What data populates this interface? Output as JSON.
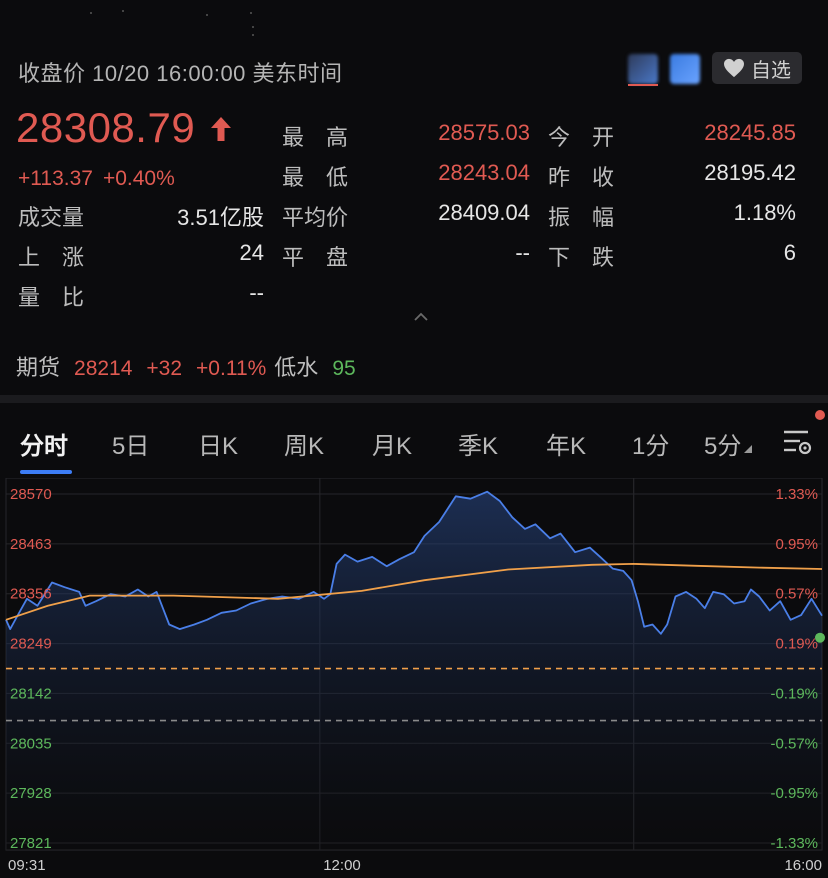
{
  "header": {
    "title": "收盘价 10/20 16:00:00 美东时间",
    "watchlist_label": "自选"
  },
  "quote": {
    "last": "28308.79",
    "change": "+113.37",
    "change_pct": "+0.40%"
  },
  "stats": [
    {
      "label": "最　高",
      "value": "28575.03",
      "color": "red"
    },
    {
      "label": "今　开",
      "value": "28245.85",
      "color": "red"
    },
    {
      "label": "最　低",
      "value": "28243.04",
      "color": "red"
    },
    {
      "label": "昨　收",
      "value": "28195.42",
      "color": "white"
    },
    {
      "label": "成交量",
      "value": "3.51亿股",
      "color": "white"
    },
    {
      "label": "平均价",
      "value": "28409.04",
      "color": "white"
    },
    {
      "label": "振　幅",
      "value": "1.18%",
      "color": "white"
    },
    {
      "label": "上　涨",
      "value": "24",
      "color": "white"
    },
    {
      "label": "平　盘",
      "value": "--",
      "color": "white"
    },
    {
      "label": "下　跌",
      "value": "6",
      "color": "white"
    },
    {
      "label": "量　比",
      "value": "--",
      "color": "white"
    }
  ],
  "futures": {
    "label": "期货",
    "price": "28214",
    "change": "+32",
    "change_pct": "+0.11%",
    "basis_label": "低水",
    "basis": "95"
  },
  "tabs": [
    "分时",
    "5日",
    "日K",
    "周K",
    "月K",
    "季K",
    "年K",
    "1分",
    "5分"
  ],
  "active_tab": 0,
  "colors": {
    "up": "#e05a52",
    "down": "#5db85c",
    "price_line": "#4a7fe8",
    "avg_line": "#f0a04a",
    "accent": "#3d7df5"
  },
  "icons": {
    "watchlist": "heart-icon",
    "direction": "up-arrow-icon",
    "expand": "chevron-up-icon",
    "settings": "chart-settings-icon"
  },
  "chart_data": {
    "type": "line",
    "title": "",
    "xlabel": "",
    "ylabel": "",
    "x_ticks": [
      "09:31",
      "12:00",
      "16:00"
    ],
    "y_ticks_left": [
      "28570",
      "28463",
      "28356",
      "28249",
      "28142",
      "28035",
      "27928",
      "27821"
    ],
    "y_ticks_right": [
      "1.33%",
      "0.95%",
      "0.57%",
      "0.19%",
      "-0.19%",
      "-0.57%",
      "-0.95%",
      "-1.33%"
    ],
    "ylim": [
      27821,
      28570
    ],
    "prev_close": 28195.42,
    "session_minutes": 390,
    "grid": true,
    "series": [
      {
        "name": "",
        "role": "price",
        "points": [
          [
            0,
            28300
          ],
          [
            2,
            28280
          ],
          [
            5,
            28305
          ],
          [
            10,
            28345
          ],
          [
            15,
            28330
          ],
          [
            22,
            28380
          ],
          [
            28,
            28370
          ],
          [
            35,
            28360
          ],
          [
            38,
            28330
          ],
          [
            43,
            28340
          ],
          [
            50,
            28355
          ],
          [
            57,
            28350
          ],
          [
            63,
            28365
          ],
          [
            68,
            28350
          ],
          [
            72,
            28360
          ],
          [
            75,
            28325
          ],
          [
            78,
            28290
          ],
          [
            83,
            28280
          ],
          [
            90,
            28290
          ],
          [
            96,
            28300
          ],
          [
            103,
            28315
          ],
          [
            110,
            28320
          ],
          [
            117,
            28335
          ],
          [
            125,
            28345
          ],
          [
            132,
            28350
          ],
          [
            140,
            28345
          ],
          [
            147,
            28360
          ],
          [
            152,
            28345
          ],
          [
            155,
            28355
          ],
          [
            158,
            28420
          ],
          [
            162,
            28440
          ],
          [
            168,
            28425
          ],
          [
            175,
            28435
          ],
          [
            182,
            28415
          ],
          [
            188,
            28430
          ],
          [
            195,
            28445
          ],
          [
            200,
            28480
          ],
          [
            207,
            28510
          ],
          [
            215,
            28565
          ],
          [
            222,
            28560
          ],
          [
            230,
            28575
          ],
          [
            236,
            28555
          ],
          [
            242,
            28520
          ],
          [
            248,
            28495
          ],
          [
            253,
            28505
          ],
          [
            260,
            28475
          ],
          [
            265,
            28485
          ],
          [
            272,
            28445
          ],
          [
            279,
            28455
          ],
          [
            284,
            28435
          ],
          [
            290,
            28410
          ],
          [
            295,
            28405
          ],
          [
            299,
            28385
          ],
          [
            302,
            28340
          ],
          [
            305,
            28285
          ],
          [
            309,
            28290
          ],
          [
            313,
            28270
          ],
          [
            316,
            28290
          ],
          [
            320,
            28350
          ],
          [
            325,
            28360
          ],
          [
            330,
            28345
          ],
          [
            334,
            28325
          ],
          [
            338,
            28360
          ],
          [
            343,
            28355
          ],
          [
            348,
            28335
          ],
          [
            353,
            28340
          ],
          [
            356,
            28365
          ],
          [
            360,
            28350
          ],
          [
            365,
            28320
          ],
          [
            370,
            28340
          ],
          [
            375,
            28300
          ],
          [
            380,
            28310
          ],
          [
            385,
            28345
          ],
          [
            390,
            28308.79
          ]
        ]
      },
      {
        "name": "",
        "role": "average",
        "points": [
          [
            0,
            28300
          ],
          [
            20,
            28330
          ],
          [
            40,
            28352
          ],
          [
            80,
            28352
          ],
          [
            130,
            28345
          ],
          [
            170,
            28362
          ],
          [
            200,
            28385
          ],
          [
            240,
            28408
          ],
          [
            280,
            28418
          ],
          [
            300,
            28420
          ],
          [
            330,
            28416
          ],
          [
            360,
            28412
          ],
          [
            390,
            28409.04
          ]
        ]
      }
    ]
  }
}
